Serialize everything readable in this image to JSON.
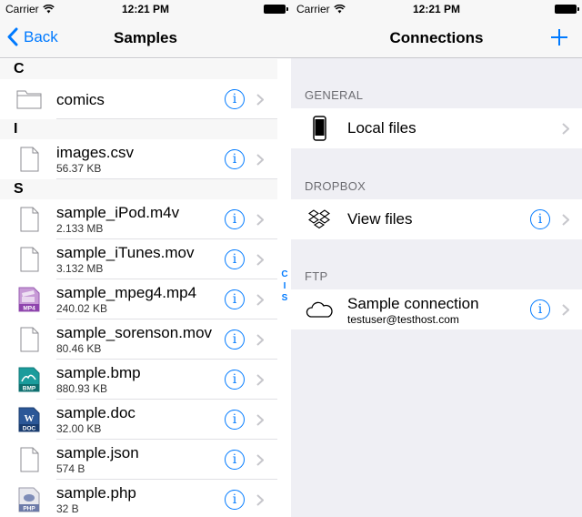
{
  "status": {
    "carrier": "Carrier",
    "time": "12:21 PM"
  },
  "left": {
    "nav": {
      "back_label": "Back",
      "title": "Samples"
    },
    "sections": [
      {
        "letter": "C",
        "items": [
          {
            "name": "comics",
            "size": "",
            "icon": "folder-icon"
          }
        ]
      },
      {
        "letter": "I",
        "items": [
          {
            "name": "images.csv",
            "size": "56.37 KB",
            "icon": "file-icon"
          }
        ]
      },
      {
        "letter": "S",
        "items": [
          {
            "name": "sample_iPod.m4v",
            "size": "2.133 MB",
            "icon": "file-icon"
          },
          {
            "name": "sample_iTunes.mov",
            "size": "3.132 MB",
            "icon": "file-icon"
          },
          {
            "name": "sample_mpeg4.mp4",
            "size": "240.02 KB",
            "icon": "mp4-file-icon"
          },
          {
            "name": "sample_sorenson.mov",
            "size": "80.46 KB",
            "icon": "file-icon"
          },
          {
            "name": "sample.bmp",
            "size": "880.93 KB",
            "icon": "bmp-file-icon"
          },
          {
            "name": "sample.doc",
            "size": "32.00 KB",
            "icon": "doc-file-icon"
          },
          {
            "name": "sample.json",
            "size": "574 B",
            "icon": "file-icon"
          },
          {
            "name": "sample.php",
            "size": "32 B",
            "icon": "php-file-icon"
          }
        ]
      }
    ],
    "index_letters": [
      "C",
      "I",
      "S"
    ],
    "badges": {
      "mp4": "MP4",
      "bmp": "BMP",
      "doc": "DOC",
      "doc_letter": "W",
      "php": "PHP"
    }
  },
  "right": {
    "nav": {
      "title": "Connections"
    },
    "groups": {
      "general": {
        "label": "GENERAL",
        "item": "Local files"
      },
      "dropbox": {
        "label": "DROPBOX",
        "item": "View files"
      },
      "ftp": {
        "label": "FTP",
        "item": "Sample connection",
        "sub": "testuser@testhost.com"
      }
    }
  },
  "colors": {
    "accent": "#007aff",
    "separator": "#c8c7cc",
    "group_bg": "#efeff4"
  }
}
